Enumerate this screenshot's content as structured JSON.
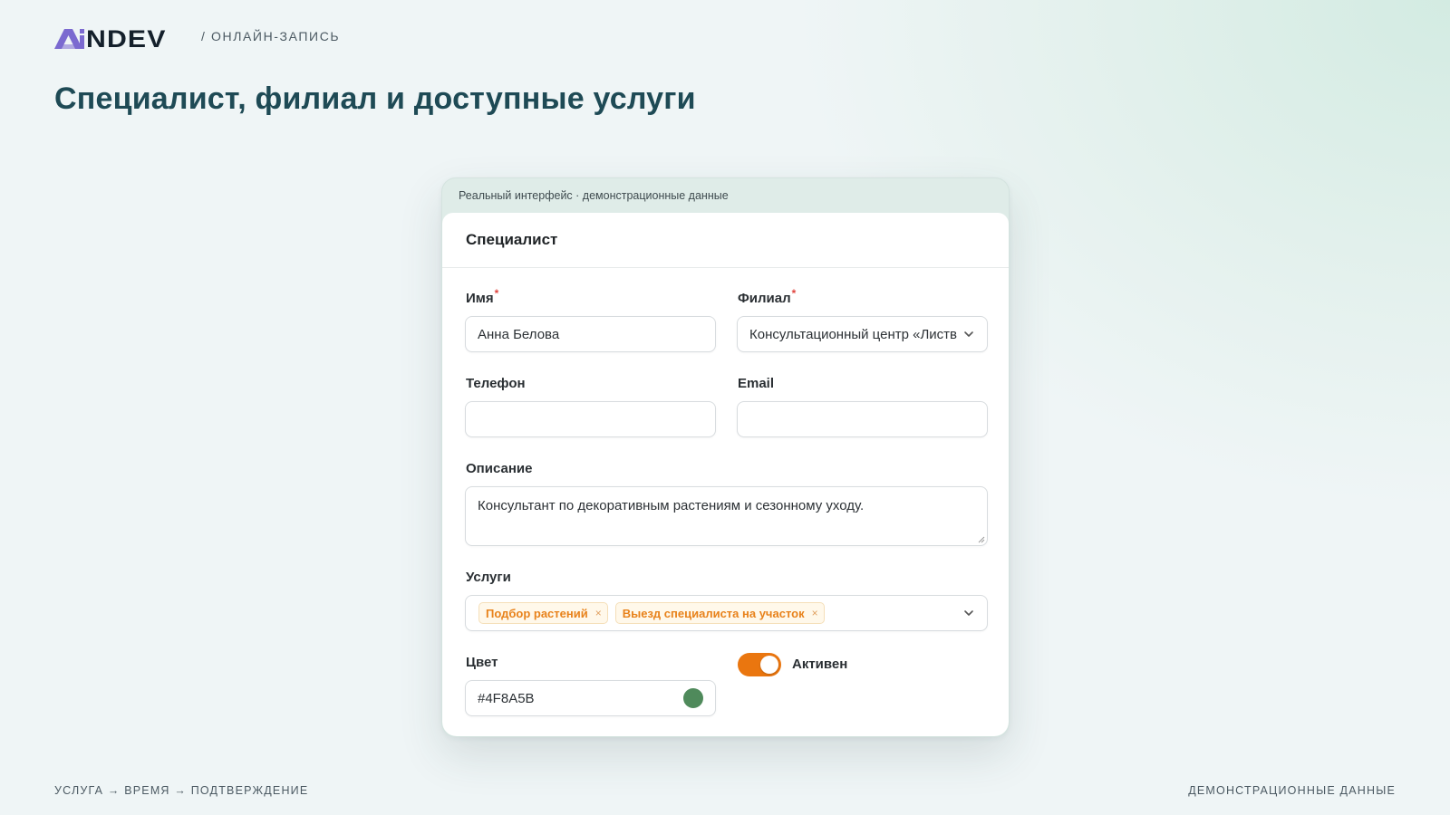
{
  "header": {
    "logo_text": "AINDEV",
    "breadcrumb": "/ ОНЛАЙН-ЗАПИСЬ"
  },
  "page_title": "Специалист, филиал и доступные услуги",
  "card": {
    "note": "Реальный интерфейс · демонстрационные данные",
    "form_title": "Специалист",
    "fields": {
      "name": {
        "label": "Имя",
        "required_mark": "*",
        "value": "Анна Белова"
      },
      "branch": {
        "label": "Филиал",
        "required_mark": "*",
        "value": "Консультационный центр «Листва»",
        "icon": "chevron-down-icon"
      },
      "phone": {
        "label": "Телефон",
        "value": ""
      },
      "email": {
        "label": "Email",
        "value": ""
      },
      "description": {
        "label": "Описание",
        "value": "Консультант по декоративным растениям и сезонному уходу."
      },
      "services": {
        "label": "Услуги",
        "tags": [
          "Подбор растений",
          "Выезд специалиста на участок"
        ],
        "remove_symbol": "×",
        "icon": "chevron-down-icon"
      },
      "color": {
        "label": "Цвет",
        "value": "#4F8A5B",
        "swatch": "#4F8A5B"
      },
      "active": {
        "label": "Активен",
        "on": true
      }
    }
  },
  "footer": {
    "flow": "УСЛУГА → ВРЕМЯ → ПОДТВЕРЖДЕНИЕ",
    "note": "ДЕМОНСТРАЦИОННЫЕ ДАННЫЕ"
  },
  "colors": {
    "title": "#1e4a55",
    "accent_orange": "#ea760f",
    "tag_text": "#e8821b",
    "required": "#e0443e",
    "logo_accent": "#7b6ad0"
  }
}
